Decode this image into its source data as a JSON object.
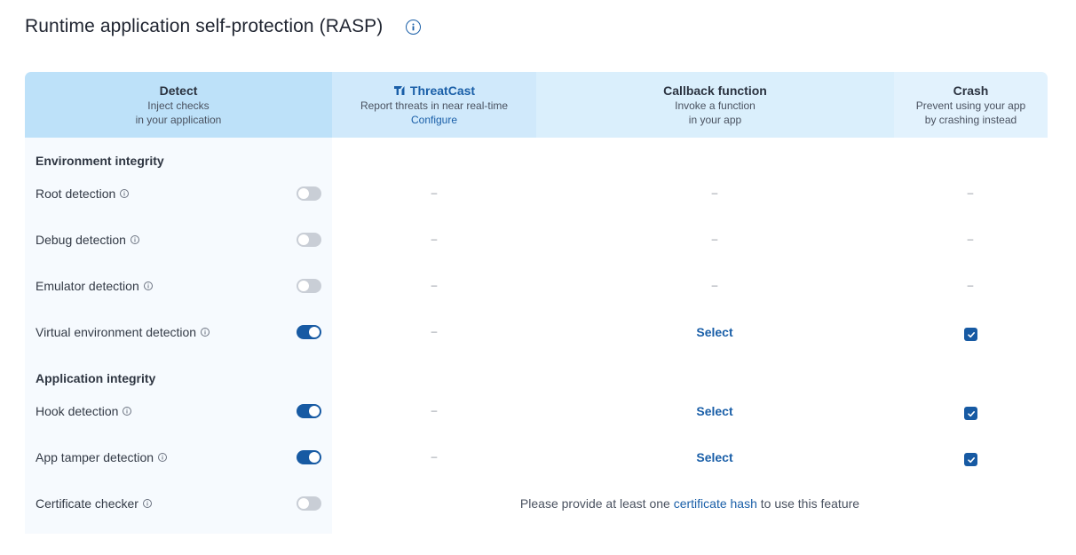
{
  "title": "Runtime application self-protection (RASP)",
  "headers": {
    "detect": {
      "title": "Detect",
      "sub": "Inject checks\nin your application"
    },
    "threatcast": {
      "title": "ThreatCast",
      "sub": "Report threats in near real-time",
      "link": "Configure"
    },
    "callback": {
      "title": "Callback function",
      "sub": "Invoke a function\nin your app"
    },
    "crash": {
      "title": "Crash",
      "sub": "Prevent using your app\nby crashing instead"
    }
  },
  "sections": {
    "environment": "Environment integrity",
    "application": "Application integrity"
  },
  "rows": [
    {
      "label": "Root detection",
      "enabled": false,
      "threatcast": "–",
      "callback": "–",
      "crash": "–"
    },
    {
      "label": "Debug detection",
      "enabled": false,
      "threatcast": "–",
      "callback": "–",
      "crash": "–"
    },
    {
      "label": "Emulator detection",
      "enabled": false,
      "threatcast": "–",
      "callback": "–",
      "crash": "–"
    },
    {
      "label": "Virtual environment detection",
      "enabled": true,
      "threatcast": "–",
      "callback": "Select",
      "crash": true
    },
    {
      "label": "Hook detection",
      "enabled": true,
      "threatcast": "–",
      "callback": "Select",
      "crash": true
    },
    {
      "label": "App tamper detection",
      "enabled": true,
      "threatcast": "–",
      "callback": "Select",
      "crash": true
    },
    {
      "label": "Certificate checker",
      "enabled": false
    }
  ],
  "certificate_message": {
    "before": "Please provide at least one ",
    "link": "certificate hash",
    "after": " to use this feature"
  },
  "colors": {
    "accent": "#175aa3",
    "header_detect": "#bde1f9",
    "header_threatcast": "#d0e9fb",
    "header_callback": "#daeffc",
    "header_crash": "#e2f2fd"
  },
  "icons": {
    "title_info": "info-icon",
    "row_info": "info-icon",
    "threatcast_logo": "threatcast-logo-icon",
    "checkbox": "check-icon"
  }
}
